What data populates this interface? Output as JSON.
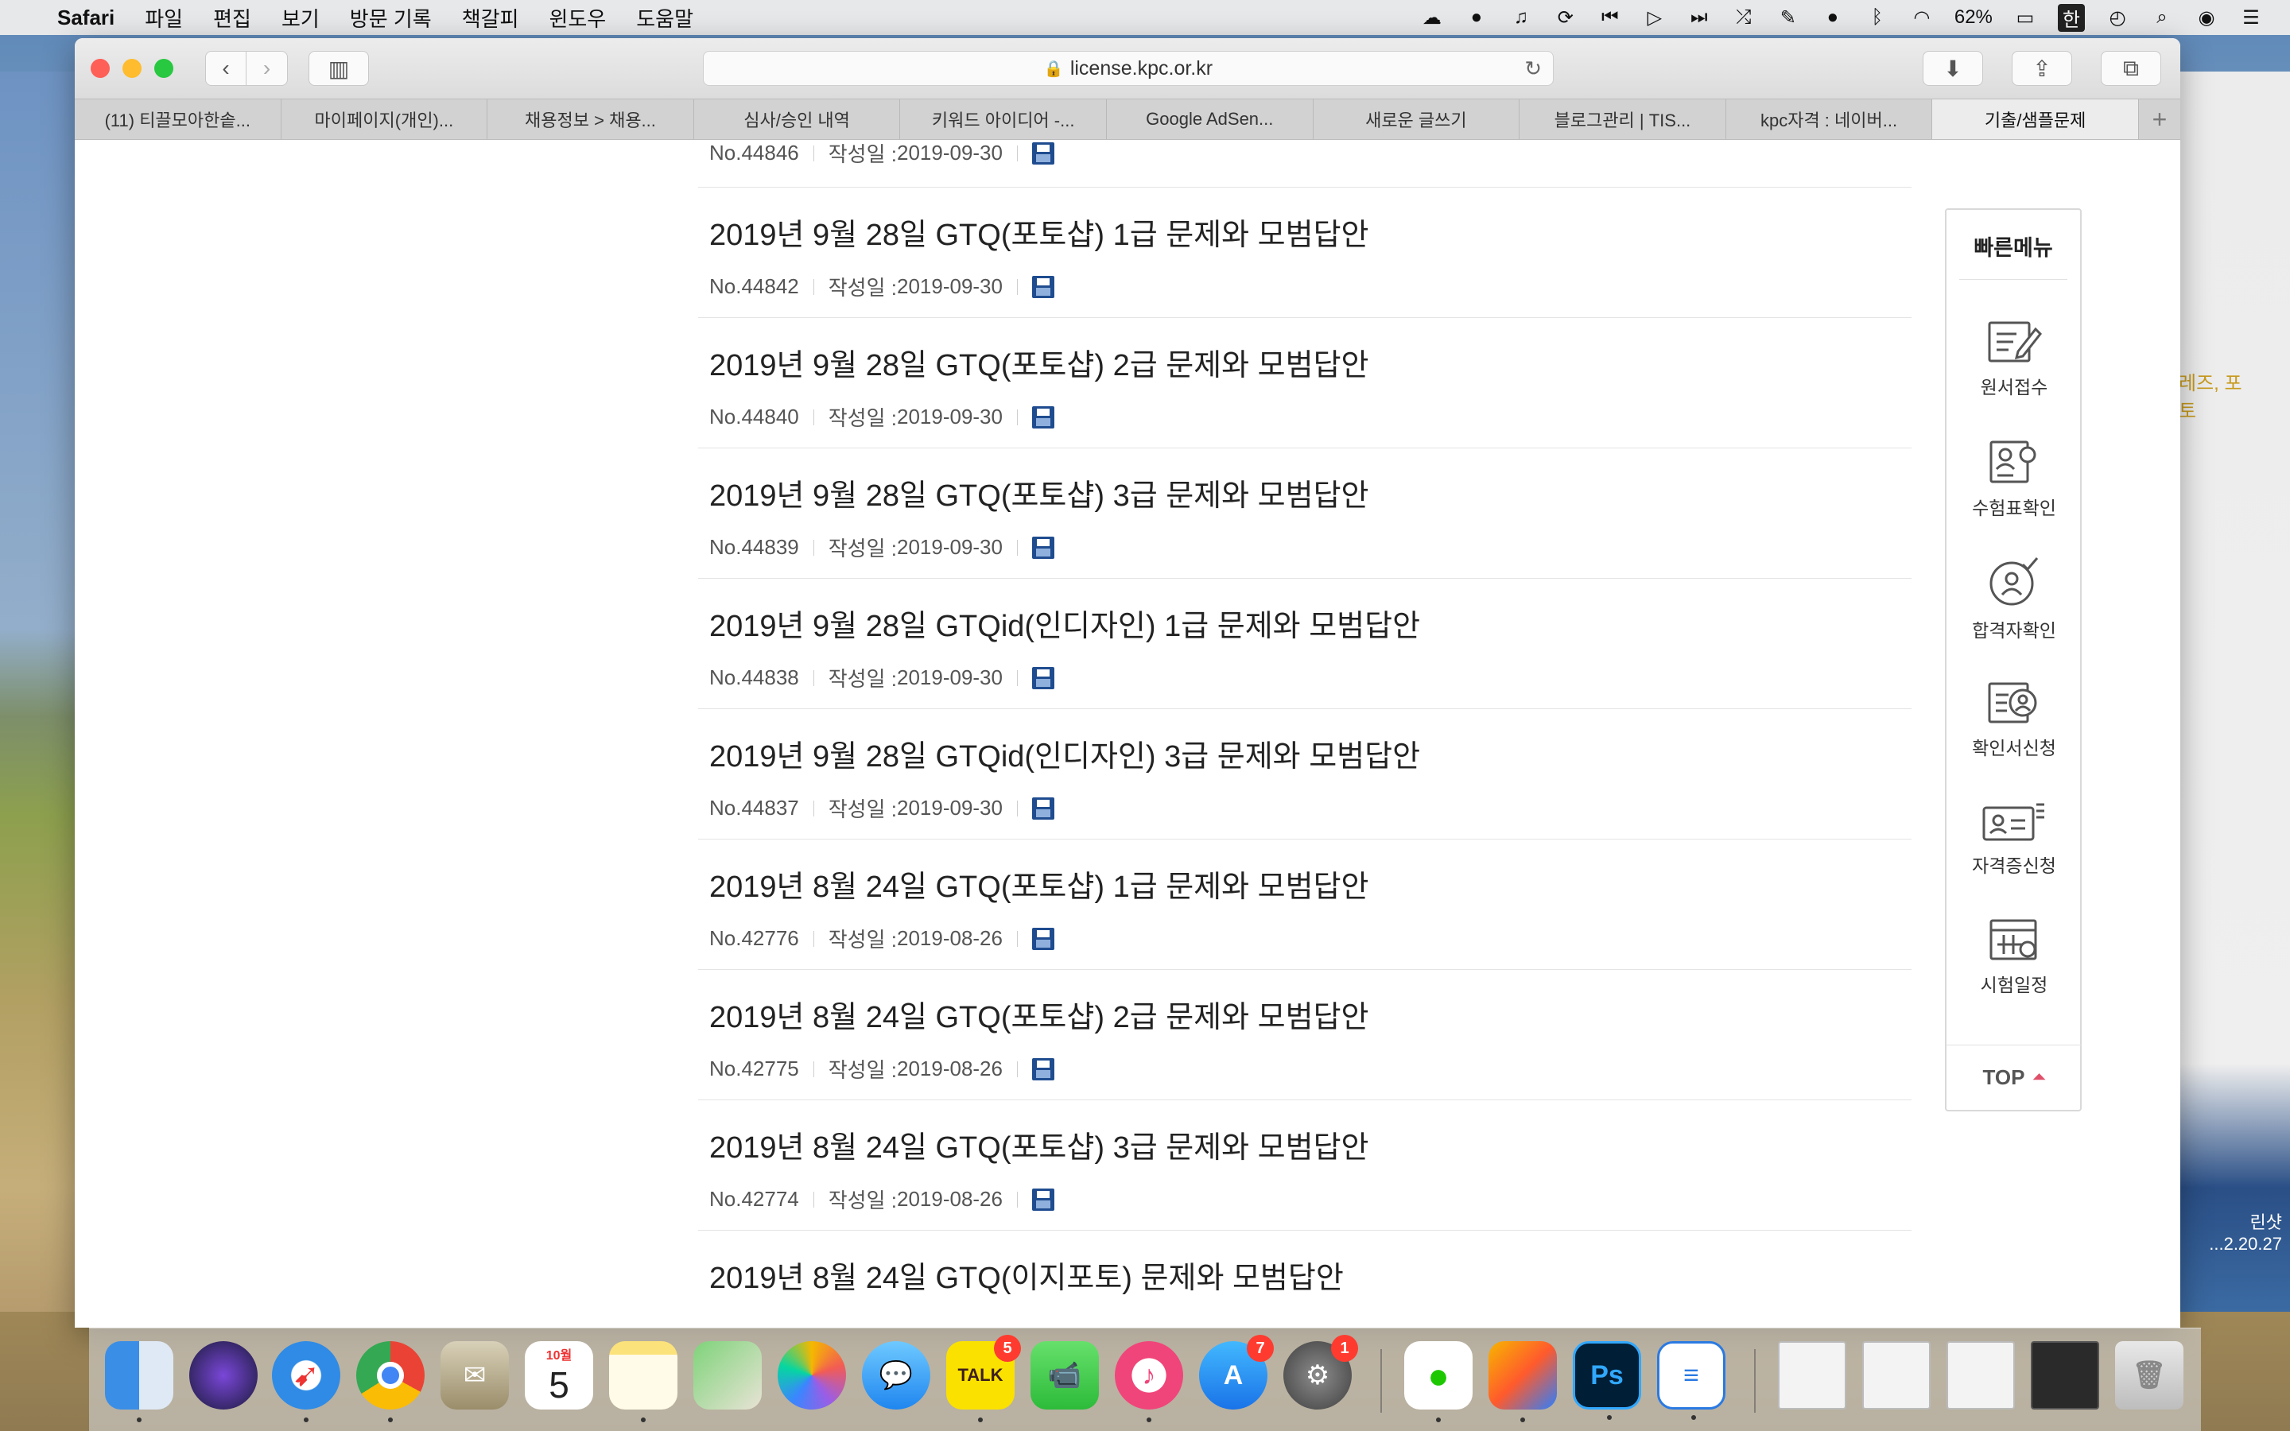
{
  "menubar": {
    "app_name": "Safari",
    "items": [
      "파일",
      "편집",
      "보기",
      "방문 기록",
      "책갈피",
      "윈도우",
      "도움말"
    ],
    "battery": "62%",
    "input_method": "한"
  },
  "browser": {
    "url": "license.kpc.or.kr",
    "tabs": [
      "(11) 티끌모아한솥...",
      "마이페이지(개인)...",
      "채용정보 > 채용...",
      "심사/승인 내역",
      "키워드 아이디어 -...",
      "Google AdSen...",
      "새로운 글쓰기",
      "블로그관리 | TIS...",
      "kpc자격 : 네이버...",
      "기출/샘플문제"
    ],
    "active_tab_index": 9
  },
  "list": {
    "number_prefix": "No.",
    "date_label": "작성일 : ",
    "partial_top": {
      "no": "No.44846",
      "date": "2019-09-30"
    },
    "rows": [
      {
        "title": "2019년 9월 28일 GTQ(포토샵) 1급 문제와 모범답안",
        "no": "No.44842",
        "date": "2019-09-30"
      },
      {
        "title": "2019년 9월 28일 GTQ(포토샵) 2급 문제와 모범답안",
        "no": "No.44840",
        "date": "2019-09-30"
      },
      {
        "title": "2019년 9월 28일 GTQ(포토샵) 3급 문제와 모범답안",
        "no": "No.44839",
        "date": "2019-09-30"
      },
      {
        "title": "2019년 9월 28일 GTQid(인디자인) 1급 문제와 모범답안",
        "no": "No.44838",
        "date": "2019-09-30"
      },
      {
        "title": "2019년 9월 28일 GTQid(인디자인) 3급 문제와 모범답안",
        "no": "No.44837",
        "date": "2019-09-30"
      },
      {
        "title": "2019년 8월 24일 GTQ(포토샵) 1급 문제와 모범답안",
        "no": "No.42776",
        "date": "2019-08-26"
      },
      {
        "title": "2019년 8월 24일 GTQ(포토샵) 2급 문제와 모범답안",
        "no": "No.42775",
        "date": "2019-08-26"
      },
      {
        "title": "2019년 8월 24일 GTQ(포토샵) 3급 문제와 모범답안",
        "no": "No.42774",
        "date": "2019-08-26"
      }
    ],
    "partial_bottom_title": "2019년 8월 24일 GTQ(이지포토) 문제와 모범답안"
  },
  "quick_menu": {
    "title": "빠른메뉴",
    "items": [
      {
        "label": "원서접수",
        "icon": "application-form-icon"
      },
      {
        "label": "수험표확인",
        "icon": "admission-ticket-icon"
      },
      {
        "label": "합격자확인",
        "icon": "pass-check-icon"
      },
      {
        "label": "확인서신청",
        "icon": "certificate-request-icon"
      },
      {
        "label": "자격증신청",
        "icon": "license-card-icon"
      },
      {
        "label": "시험일정",
        "icon": "calendar-icon"
      }
    ],
    "top_label": "TOP"
  },
  "desktop": {
    "peek_link": "레즈, 포토",
    "peek_file_line1": "린샷",
    "peek_file_line2": "...2.20.27"
  },
  "dock": {
    "calendar_month": "10월",
    "calendar_day": "5",
    "kakao_label": "TALK",
    "kakao_badge": "5",
    "appstore_badge": "7",
    "settings_badge": "1"
  }
}
